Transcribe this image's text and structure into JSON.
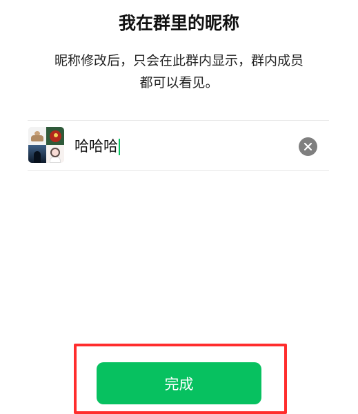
{
  "header": {
    "title": "我在群里的昵称"
  },
  "description": {
    "line1": "昵称修改后，只会在此群内显示，群内成员",
    "line2": "都可以看见。"
  },
  "nickname": {
    "value": "哈哈哈"
  },
  "icons": {
    "avatar": "group-avatar-icon",
    "clear": "clear-icon"
  },
  "actions": {
    "done_label": "完成"
  },
  "colors": {
    "accent": "#07c160",
    "highlight": "#ff2d2d",
    "clear_button": "#7f7f7f"
  }
}
